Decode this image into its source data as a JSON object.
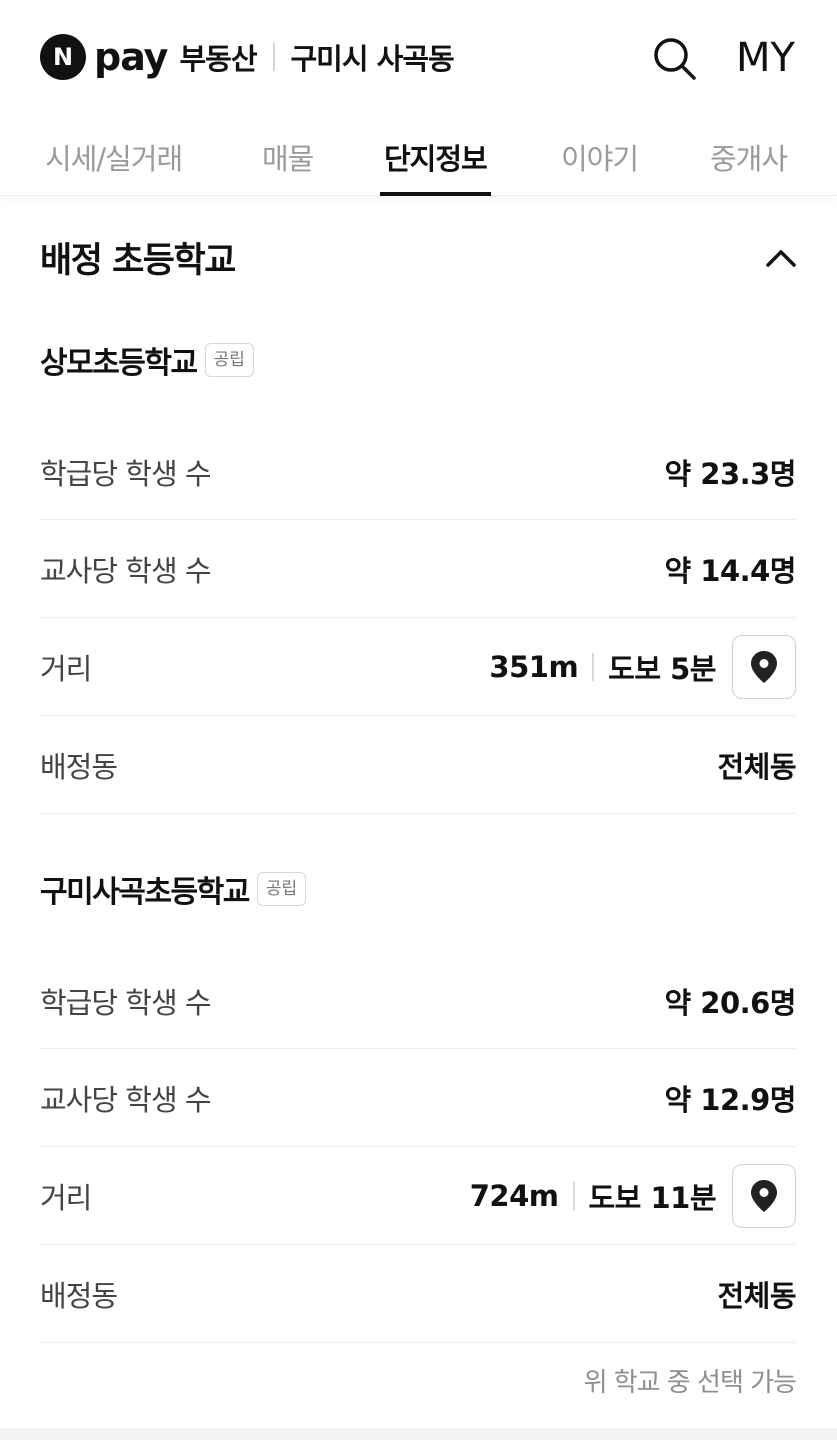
{
  "header": {
    "logo_n": "N",
    "logo_pay": "pay",
    "service": "부동산",
    "region": "구미시 사곡동",
    "my_label": "MY"
  },
  "tabs": [
    {
      "label": "시세/실거래",
      "active": false
    },
    {
      "label": "매물",
      "active": false
    },
    {
      "label": "단지정보",
      "active": true
    },
    {
      "label": "이야기",
      "active": false
    },
    {
      "label": "중개사",
      "active": false
    }
  ],
  "section": {
    "title": "배정 초등학교"
  },
  "schools": [
    {
      "name": "상모초등학교",
      "type_badge": "공립",
      "rows": {
        "class_label": "학급당 학생 수",
        "class_value": "약 23.3명",
        "teacher_label": "교사당 학생 수",
        "teacher_value": "약 14.4명",
        "distance_label": "거리",
        "distance_m": "351m",
        "distance_walk": "도보 5분",
        "dong_label": "배정동",
        "dong_value": "전체동"
      }
    },
    {
      "name": "구미사곡초등학교",
      "type_badge": "공립",
      "rows": {
        "class_label": "학급당 학생 수",
        "class_value": "약 20.6명",
        "teacher_label": "교사당 학생 수",
        "teacher_value": "약 12.9명",
        "distance_label": "거리",
        "distance_m": "724m",
        "distance_walk": "도보 11분",
        "dong_label": "배정동",
        "dong_value": "전체동"
      }
    }
  ],
  "footnote": "위 학교 중 선택 가능",
  "icons": {
    "search": "search-icon",
    "collapse": "chevron-up-icon",
    "map": "map-pin-icon"
  }
}
